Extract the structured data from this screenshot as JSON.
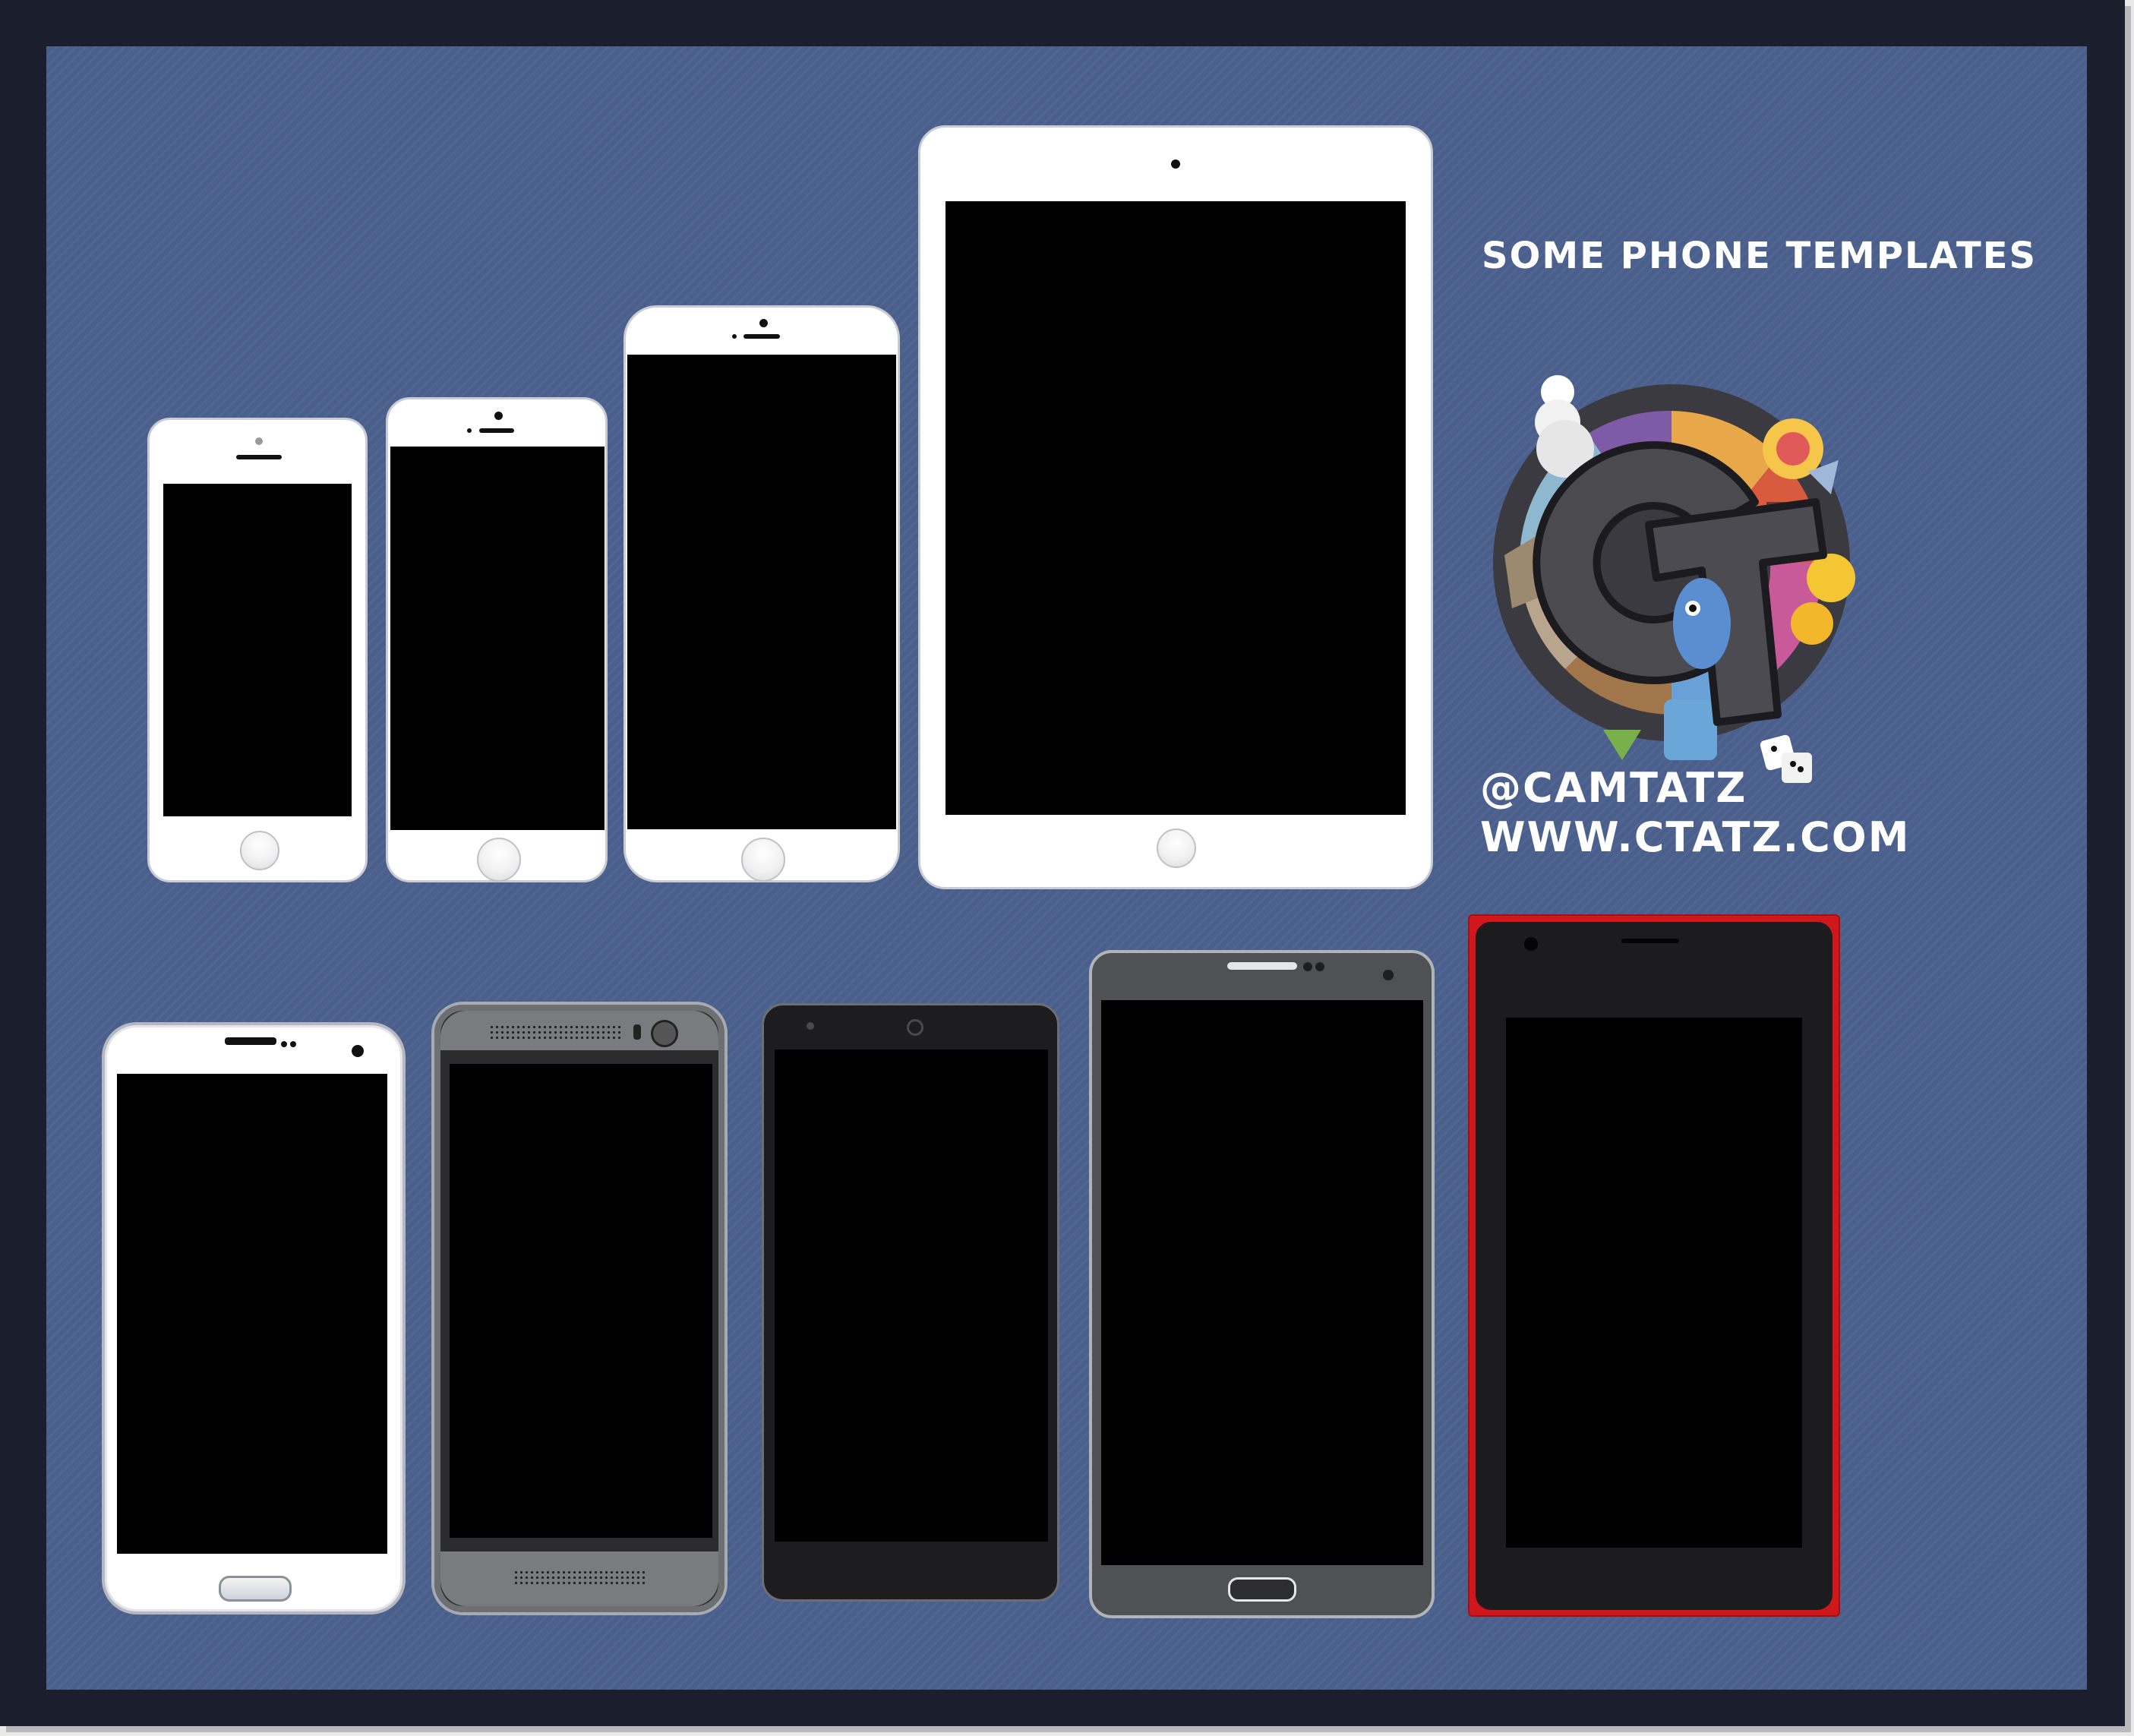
{
  "title": "SOME PHONE TEMPLATES",
  "handle": "@CAMTATZ",
  "website": "WWW.CTATZ.COM",
  "logo": {
    "name": "ct-monogram-logo",
    "letters": "CT"
  },
  "colors": {
    "frame": "#1b1f2d",
    "background": "#4a5f8b",
    "text": "#ffffff",
    "screen": "#000000",
    "accent_red": "#d0181c"
  },
  "devices_top_row": [
    {
      "name": "white-phone-small",
      "color": "white"
    },
    {
      "name": "white-phone-medium",
      "color": "white"
    },
    {
      "name": "white-phone-large",
      "color": "white"
    },
    {
      "name": "white-tablet",
      "color": "white"
    }
  ],
  "devices_bottom_row": [
    {
      "name": "white-android-phone",
      "color": "white"
    },
    {
      "name": "gray-metal-phone",
      "color": "gray"
    },
    {
      "name": "black-phone",
      "color": "black"
    },
    {
      "name": "dark-gray-phablet",
      "color": "dark-gray"
    },
    {
      "name": "red-black-phone",
      "color": "red"
    }
  ]
}
